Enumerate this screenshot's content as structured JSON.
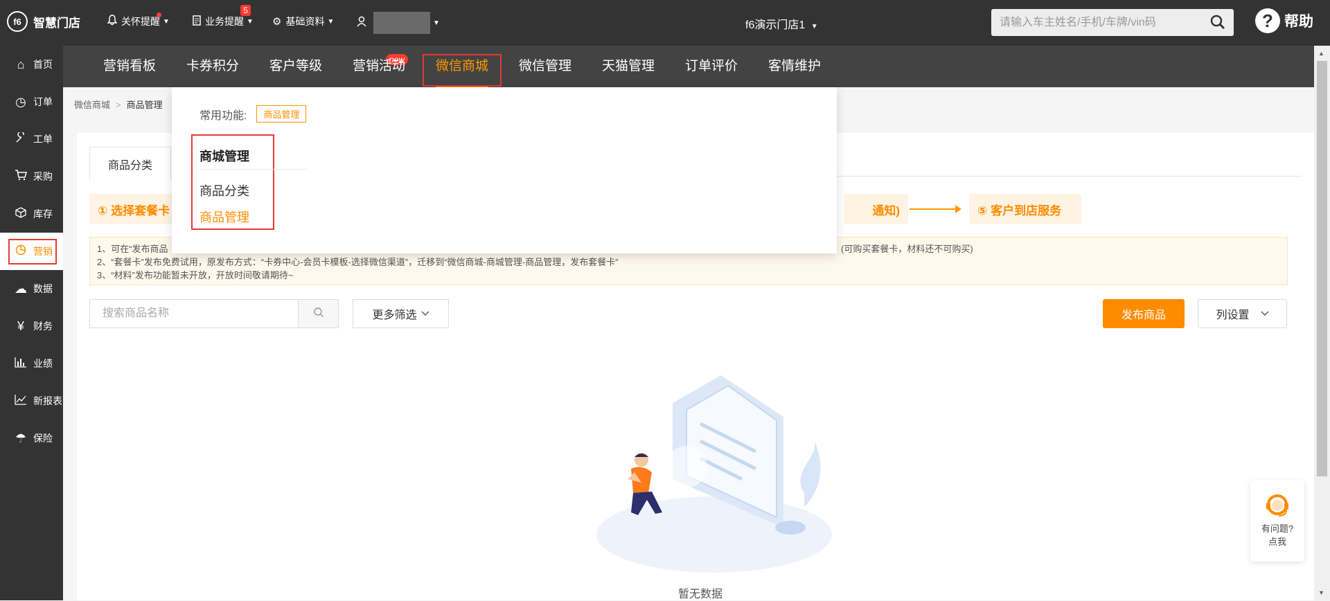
{
  "topbar": {
    "logo_text": "智慧门店",
    "logo_mark": "f6",
    "care_reminder": "关怀提醒",
    "business_reminder": "业务提醒",
    "business_badge": "5",
    "basic_data": "基础资料",
    "store_name": "f6演示门店1",
    "search_placeholder": "请输入车主姓名/手机/车牌/vin码",
    "help": "帮助"
  },
  "sidebar": {
    "items": [
      {
        "label": "首页",
        "icon": "home-icon"
      },
      {
        "label": "订单",
        "icon": "clock-icon"
      },
      {
        "label": "工单",
        "icon": "wrench-icon"
      },
      {
        "label": "采购",
        "icon": "cart-icon"
      },
      {
        "label": "库存",
        "icon": "box-icon"
      },
      {
        "label": "营销",
        "icon": "pie-chart-icon"
      },
      {
        "label": "数据",
        "icon": "cloud-icon"
      },
      {
        "label": "财务",
        "icon": "yen-icon"
      },
      {
        "label": "业绩",
        "icon": "bar-chart-icon"
      },
      {
        "label": "新报表",
        "icon": "line-chart-icon"
      },
      {
        "label": "保险",
        "icon": "umbrella-icon"
      }
    ],
    "active": "营销"
  },
  "modnav": {
    "tabs": [
      "营销看板",
      "卡券积分",
      "客户等级",
      "营销活动",
      "微信商城",
      "微信管理",
      "天猫管理",
      "订单评价",
      "客情维护"
    ],
    "active": "微信商城",
    "new_badge": "new"
  },
  "breadcrumb": {
    "root": "微信商城",
    "current": "商品管理"
  },
  "tabs": {
    "first": "商品分类"
  },
  "flow": {
    "step1": "① 选择套餐卡",
    "step5_tail": "通知)",
    "step5": "⑤ 客户到店服务"
  },
  "notice": {
    "line1": "1、可在“发布商品",
    "line1_tail": "(可购买套餐卡，材料还不可购买)",
    "line2": "2、“套餐卡”发布免费试用，原发布方式：“卡券中心-会员卡模板-选择微信渠道”，迁移到“微信商城-商城管理-商品管理，发布套餐卡”",
    "line3": "3、“材料”发布功能暂未开放，开放时间敬请期待~"
  },
  "toolbar": {
    "search_placeholder": "搜索商品名称",
    "more_filter": "更多筛选",
    "publish": "发布商品",
    "column_settings": "列设置"
  },
  "empty": {
    "text": "暂无数据"
  },
  "dropdown": {
    "common_label": "常用功能:",
    "common_tag": "商品管理",
    "section_title": "商城管理",
    "link1": "商品分类",
    "link2": "商品管理"
  },
  "float_help": {
    "line1": "有问题?",
    "line2": "点我"
  },
  "colors": {
    "accent": "#ff8c00",
    "topbar": "#333333",
    "highlight": "#e53935"
  }
}
